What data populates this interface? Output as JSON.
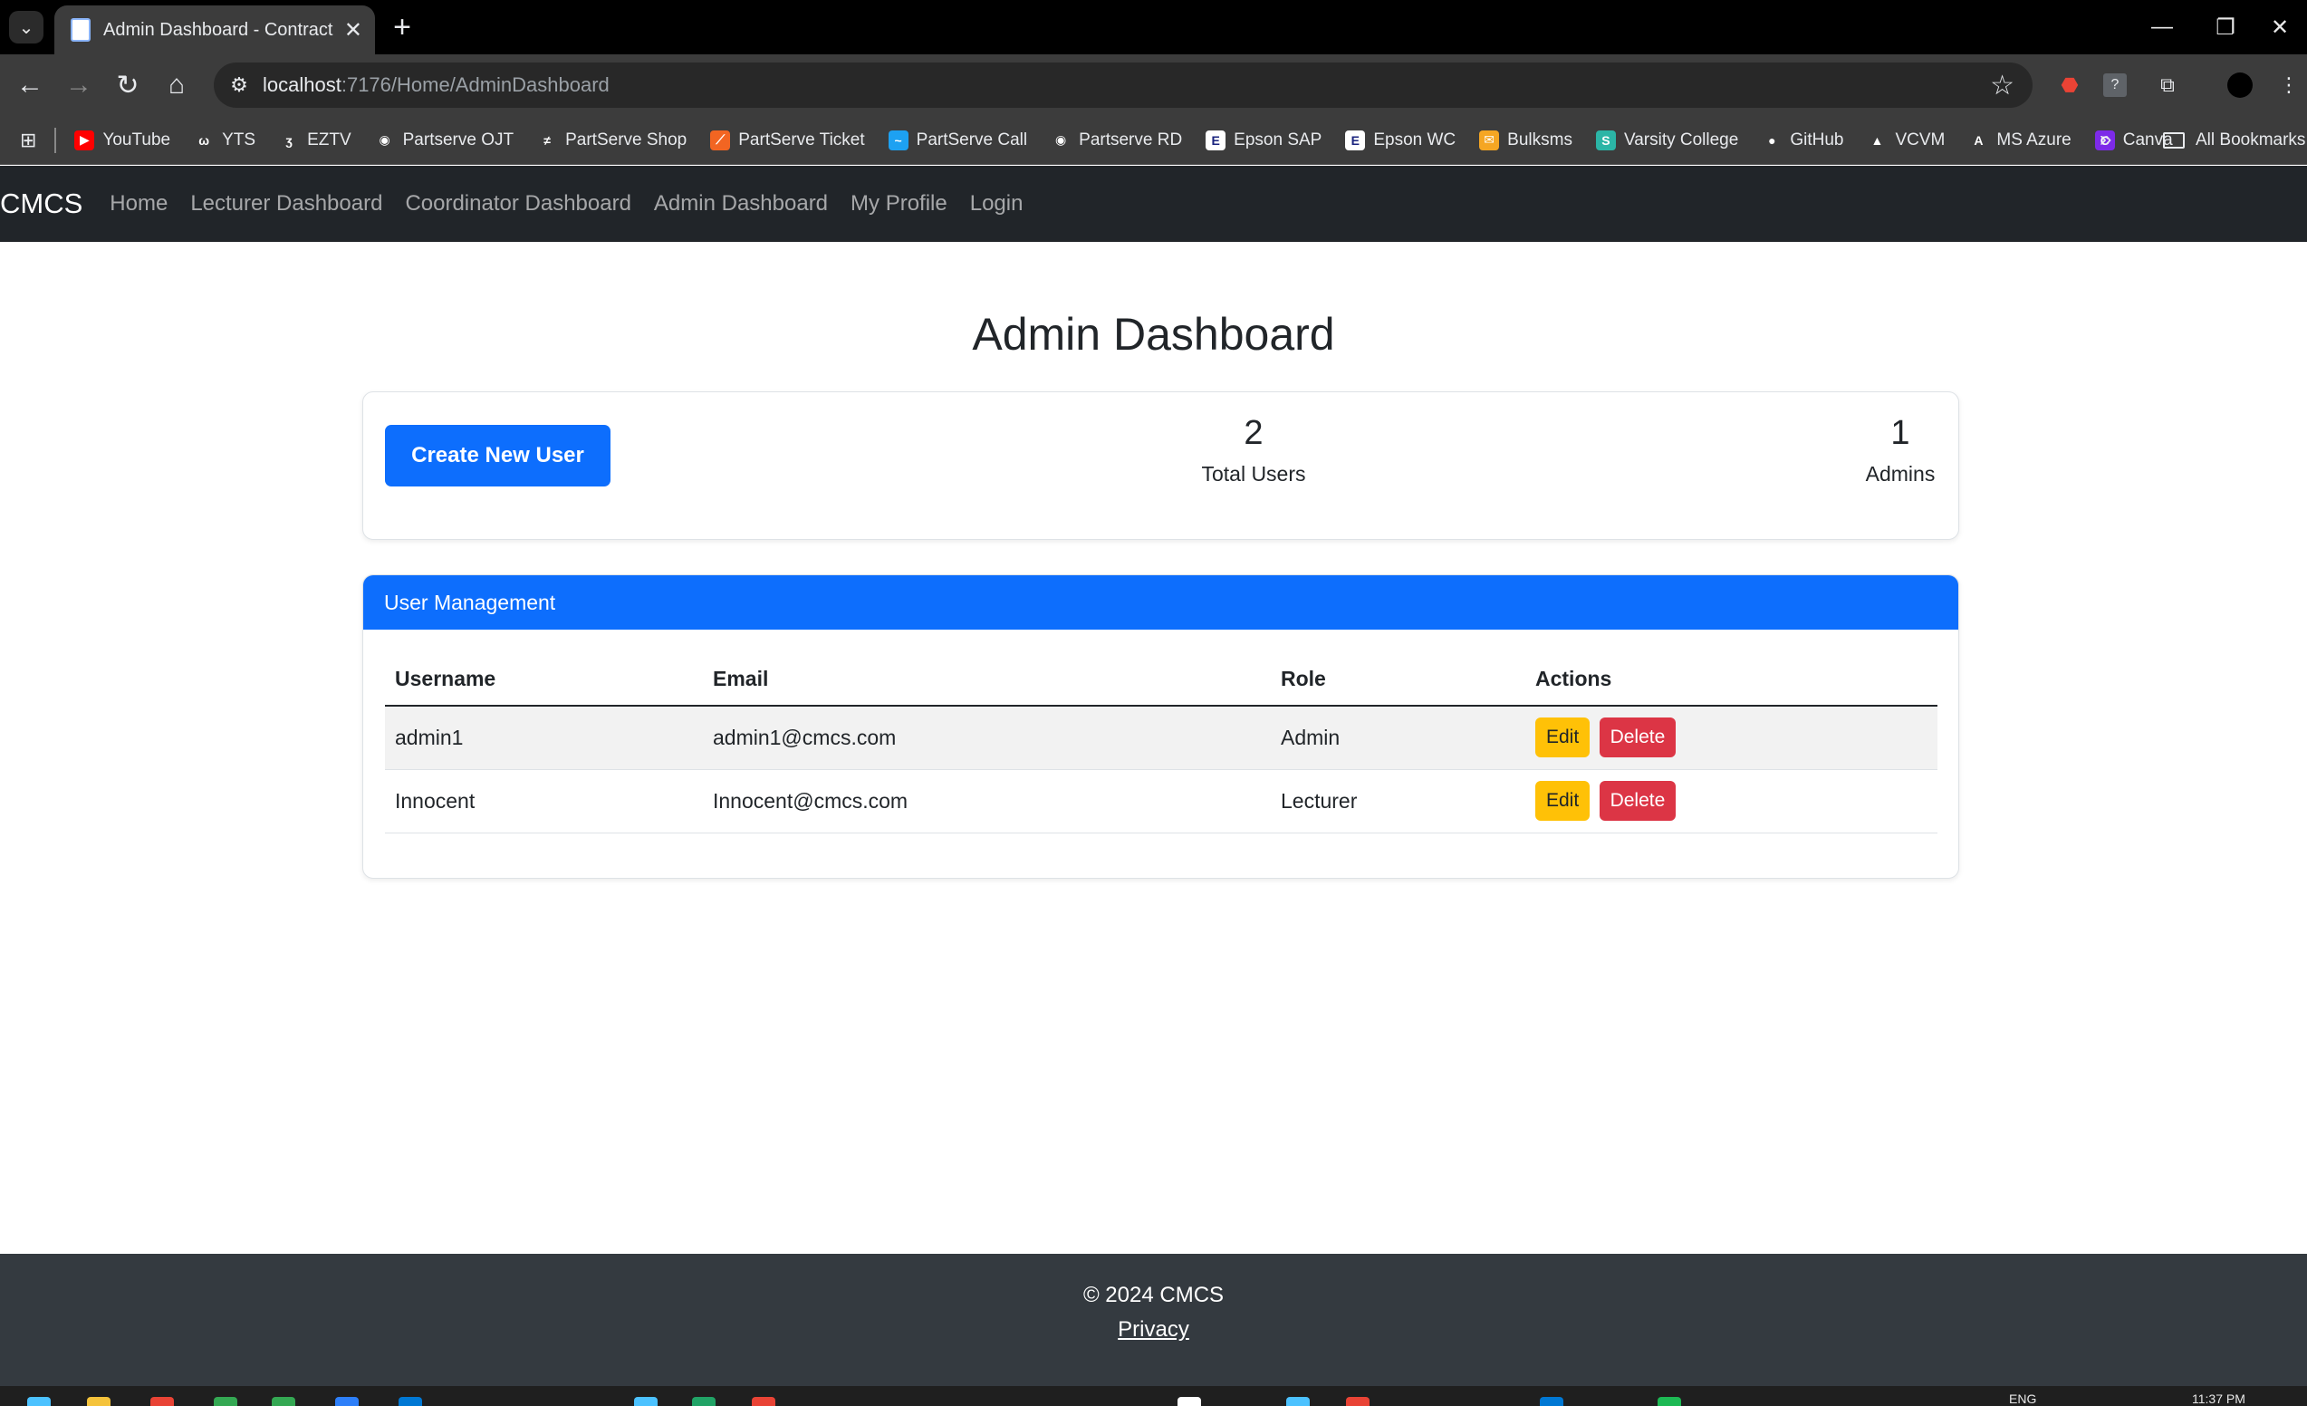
{
  "browser": {
    "tab_title": "Admin Dashboard - Contract M",
    "url_host": "localhost",
    "url_path": ":7176/Home/AdminDashboard",
    "bookmarks": [
      {
        "label": "YouTube",
        "color": "#ff0000",
        "glyph": "▶"
      },
      {
        "label": "YTS",
        "color": "#3c3c3c",
        "glyph": "ω"
      },
      {
        "label": "EZTV",
        "color": "#3c3c3c",
        "glyph": "ʒ"
      },
      {
        "label": "Partserve OJT",
        "color": "#3c3c3c",
        "glyph": "◉"
      },
      {
        "label": "PartServe Shop",
        "color": "#3c3c3c",
        "glyph": "≠"
      },
      {
        "label": "PartServe Ticket",
        "color": "#f26522",
        "glyph": "⟋"
      },
      {
        "label": "PartServe Call",
        "color": "#1da1f2",
        "glyph": "~"
      },
      {
        "label": "Partserve RD",
        "color": "#3c3c3c",
        "glyph": "◉"
      },
      {
        "label": "Epson SAP",
        "color": "#ffffff",
        "glyph": "E"
      },
      {
        "label": "Epson WC",
        "color": "#ffffff",
        "glyph": "E"
      },
      {
        "label": "Bulksms",
        "color": "#f5a623",
        "glyph": "✉"
      },
      {
        "label": "Varsity College",
        "color": "#2bb5a6",
        "glyph": "S"
      },
      {
        "label": "GitHub",
        "color": "#3c3c3c",
        "glyph": "●"
      },
      {
        "label": "VCVM",
        "color": "#3c3c3c",
        "glyph": "▲"
      },
      {
        "label": "MS Azure",
        "color": "#3c3c3c",
        "glyph": "A"
      },
      {
        "label": "Canva",
        "color": "#7d2ae8",
        "glyph": "C"
      }
    ],
    "more_bookmarks": "»",
    "all_bookmarks": "All Bookmarks"
  },
  "navbar": {
    "brand": "CMCS",
    "links": [
      "Home",
      "Lecturer Dashboard",
      "Coordinator Dashboard",
      "Admin Dashboard",
      "My Profile",
      "Login"
    ]
  },
  "main": {
    "title": "Admin Dashboard",
    "create_button": "Create New User",
    "stats": [
      {
        "value": "2",
        "label": "Total Users"
      },
      {
        "value": "1",
        "label": "Admins"
      }
    ],
    "users_card": {
      "header": "User Management",
      "columns": [
        "Username",
        "Email",
        "Role",
        "Actions"
      ],
      "rows": [
        {
          "username": "admin1",
          "email": "admin1@cmcs.com",
          "role": "Admin",
          "edit": "Edit",
          "delete": "Delete"
        },
        {
          "username": "Innocent",
          "email": "Innocent@cmcs.com",
          "role": "Lecturer",
          "edit": "Edit",
          "delete": "Delete"
        }
      ]
    }
  },
  "footer": {
    "copyright": "© 2024 CMCS",
    "privacy": "Privacy"
  },
  "taskbar": {
    "lang": "ENG",
    "time": "11:37 PM"
  }
}
